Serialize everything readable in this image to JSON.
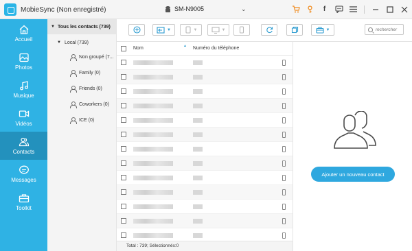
{
  "app": {
    "title": "MobieSync (Non enregistré)"
  },
  "device": {
    "name": "SM-N9005"
  },
  "titlebar_icons": [
    "cart-icon",
    "key-icon",
    "facebook-icon",
    "feedback-icon",
    "menu-icon",
    "minimize-icon",
    "maximize-icon",
    "close-icon"
  ],
  "sidebar": {
    "items": [
      {
        "label": "Accueil",
        "icon": "home-icon",
        "active": false
      },
      {
        "label": "Photos",
        "icon": "photos-icon",
        "active": false
      },
      {
        "label": "Musique",
        "icon": "music-icon",
        "active": false
      },
      {
        "label": "Vidéos",
        "icon": "video-icon",
        "active": false
      },
      {
        "label": "Contacts",
        "icon": "contacts-icon",
        "active": true
      },
      {
        "label": "Messages",
        "icon": "messages-icon",
        "active": false
      },
      {
        "label": "Toolkit",
        "icon": "toolkit-icon",
        "active": false
      }
    ]
  },
  "groups": {
    "all_label": "Tous les contacts",
    "all_count": "(739)",
    "local_label": "Local",
    "local_count": "(739)",
    "items": [
      {
        "label": "Non groupé",
        "count": "(7..."
      },
      {
        "label": "Family",
        "count": "(0)"
      },
      {
        "label": "Friends",
        "count": "(0)"
      },
      {
        "label": "Coworkers",
        "count": "(0)"
      },
      {
        "label": "ICE",
        "count": "(0)"
      }
    ]
  },
  "toolbar": {
    "search_placeholder": "rechercher",
    "buttons": [
      "add-icon",
      "import-icon",
      "export-icon",
      "export-computer-icon",
      "delete-icon",
      "refresh-icon",
      "copy-icon",
      "toolbox-icon"
    ]
  },
  "table": {
    "col_name": "Nom",
    "col_phone": "Numéro du téléphone",
    "row_count_visible": 13
  },
  "footer": {
    "status": "Total : 739; Sélectionnés:0"
  },
  "right_panel": {
    "add_button": "Ajouter un nouveau contact"
  },
  "colors": {
    "accent": "#2fb2e4",
    "active_nav": "#2391bd",
    "button": "#2fa8df",
    "orange": "#f08a1c"
  }
}
